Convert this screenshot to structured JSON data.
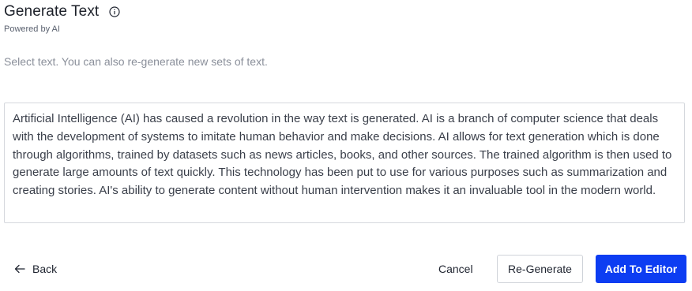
{
  "header": {
    "title": "Generate Text",
    "subtitle": "Powered by AI",
    "info_icon": "info-circle-icon"
  },
  "instruction": "Select text. You can also re-generate new sets of text.",
  "generated_text": "Artificial Intelligence (AI) has caused a revolution in the way text is generated. AI is a branch of computer science that deals with the development of systems to imitate human behavior and make decisions. AI allows for text generation which is done through algorithms, trained by datasets such as news articles, books, and other sources. The trained algorithm is then used to generate large amounts of text quickly. This technology has been put to use for various purposes such as summarization and creating stories. AI's ability to generate content without human intervention makes it an invaluable tool in the modern world.",
  "footer": {
    "back_label": "Back",
    "back_icon": "arrow-left-icon",
    "cancel_label": "Cancel",
    "regenerate_label": "Re-Generate",
    "add_label": "Add To Editor"
  },
  "colors": {
    "primary": "#0d3df2",
    "muted_text": "#8a8f9a",
    "border": "#d5d8dd"
  }
}
